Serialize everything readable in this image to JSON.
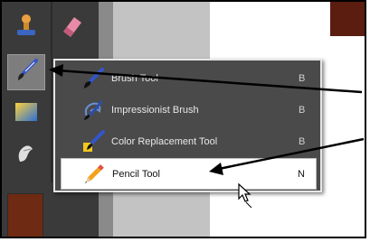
{
  "menu": {
    "items": [
      {
        "label": "Brush Tool",
        "key": "B",
        "icon": "brush-icon"
      },
      {
        "label": "Impressionist Brush",
        "key": "B",
        "icon": "impressionist-brush-icon"
      },
      {
        "label": "Color Replacement Tool",
        "key": "B",
        "icon": "color-replacement-icon"
      },
      {
        "label": "Pencil Tool",
        "key": "N",
        "icon": "pencil-icon",
        "highlighted": true
      }
    ]
  },
  "toolbox": {
    "tools": [
      "stamp-icon",
      "eraser-icon",
      "brush-icon",
      "gradient-icon",
      "smudge-icon"
    ],
    "selected": "brush-icon"
  },
  "colors": {
    "toolbox_bg": "#3a3a3a",
    "menu_bg": "#4a4a4a",
    "highlight_bg": "#ffffff",
    "swatch": "#6e2a12",
    "arrow": "#000000"
  }
}
